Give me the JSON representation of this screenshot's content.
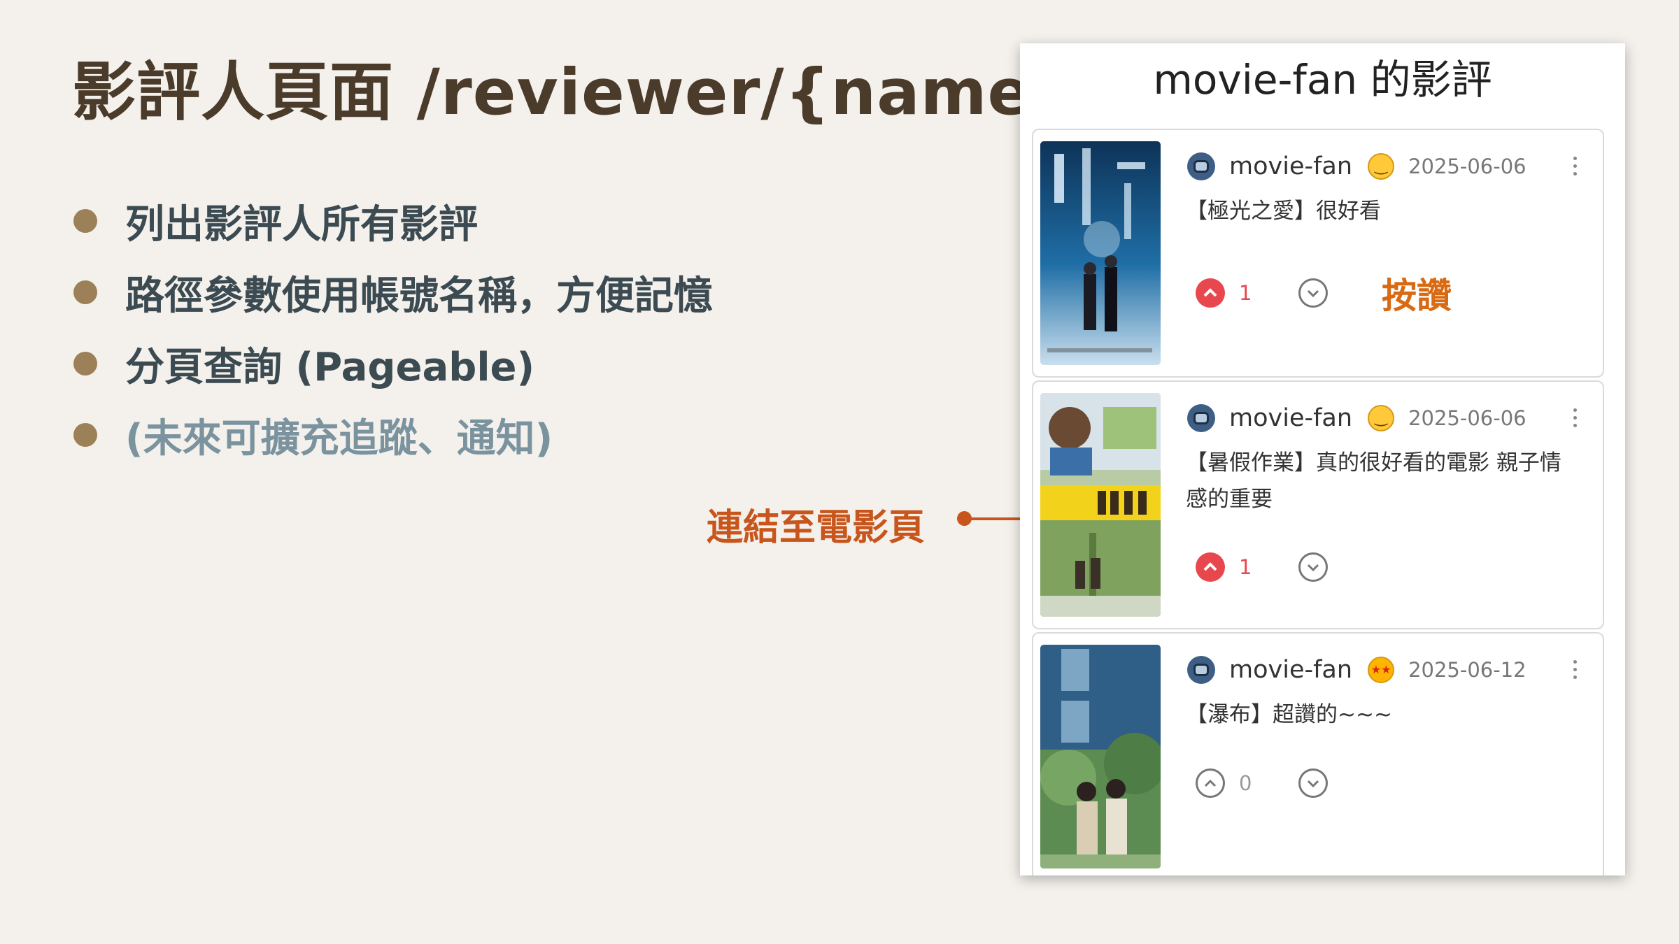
{
  "slide": {
    "title": "影評人頁面 /reviewer/{name}",
    "bullets": [
      "列出影評人所有影評",
      "路徑參數使用帳號名稱，方便記憶",
      "分頁查詢 (Pageable)",
      "(未來可擴充追蹤、通知)"
    ],
    "callout": "連結至電影頁"
  },
  "screenshot": {
    "page_title": "movie-fan 的影評",
    "like_annotation": "按讚",
    "reviews": [
      {
        "poster": "極光之愛 poster",
        "username": "movie-fan",
        "mood": "smile-emoji",
        "date": "2025-06-06",
        "text": "【極光之愛】很好看",
        "upvotes": "1",
        "upvoted": true
      },
      {
        "poster": "暑假作業 poster",
        "username": "movie-fan",
        "mood": "smile-emoji",
        "date": "2025-06-06",
        "text": "【暑假作業】真的很好看的電影 親子情感的重要",
        "upvotes": "1",
        "upvoted": true
      },
      {
        "poster": "瀑布 poster",
        "username": "movie-fan",
        "mood": "star-struck-emoji",
        "date": "2025-06-12",
        "text": "【瀑布】超讚的~~~",
        "upvotes": "0",
        "upvoted": false
      }
    ]
  },
  "colors": {
    "background": "#f4f1ec",
    "title": "#4b3b2a",
    "bullet_dot": "#9c8057",
    "bullet_text": "#3c4a52",
    "bullet_muted": "#7a939f",
    "accent": "#c8561c",
    "upvote_active": "#e8474d"
  }
}
